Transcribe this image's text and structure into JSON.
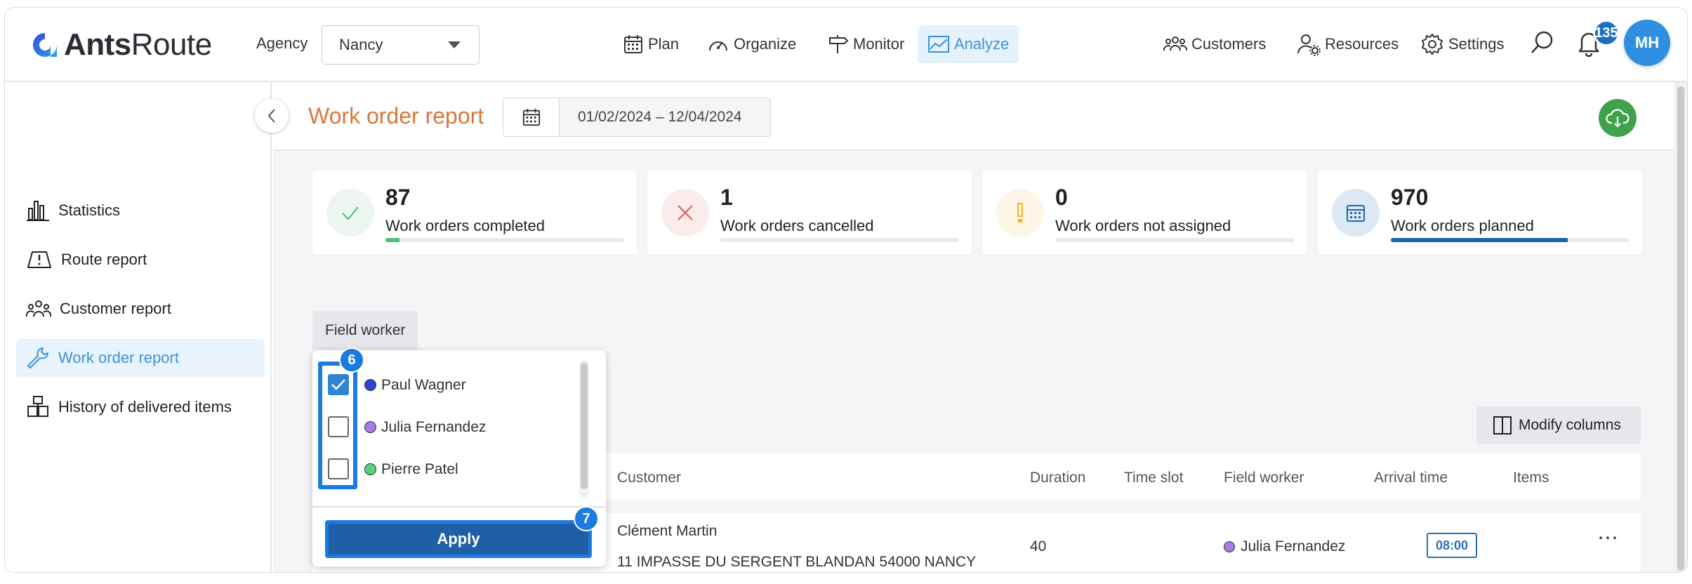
{
  "app": {
    "logo_bold": "Ants",
    "logo_rest": "Route"
  },
  "agency": {
    "label": "Agency",
    "value": "Nancy"
  },
  "nav": {
    "plan": "Plan",
    "organize": "Organize",
    "monitor": "Monitor",
    "analyze": "Analyze",
    "customers": "Customers",
    "resources": "Resources",
    "settings": "Settings"
  },
  "notifications": {
    "count": "135"
  },
  "user": {
    "initials": "MH"
  },
  "sidebar": {
    "items": [
      {
        "label": "Statistics"
      },
      {
        "label": "Route report"
      },
      {
        "label": "Customer report"
      },
      {
        "label": "Work order report"
      },
      {
        "label": "History of delivered items"
      }
    ]
  },
  "page": {
    "title": "Work order report",
    "date_range": "01/02/2024 – 12/04/2024"
  },
  "stats": [
    {
      "value": "87",
      "label": "Work orders completed",
      "fraction": 0.06,
      "color": "#4bbf7b"
    },
    {
      "value": "1",
      "label": "Work orders cancelled",
      "fraction": 0.0,
      "color": "#e05a5a"
    },
    {
      "value": "0",
      "label": "Work orders not assigned",
      "fraction": 0.0,
      "color": "#f2b320"
    },
    {
      "value": "970",
      "label": "Work orders planned",
      "fraction": 0.74,
      "color": "#1e64ad"
    }
  ],
  "filter": {
    "tab_label": "Field worker",
    "options": [
      {
        "name": "Paul Wagner",
        "checked": true,
        "color": "#2f44d6"
      },
      {
        "name": "Julia Fernandez",
        "checked": false,
        "color": "#a77ae6"
      },
      {
        "name": "Pierre Patel",
        "checked": false,
        "color": "#59d27a"
      }
    ],
    "apply_label": "Apply",
    "step_checkbox": "6",
    "step_apply": "7"
  },
  "table": {
    "modify_columns": "Modify columns",
    "headers": [
      "Customer",
      "Duration",
      "Time slot",
      "Field worker",
      "Arrival time",
      "Items"
    ],
    "rows": [
      {
        "customer": "Clément Martin",
        "address": "11 IMPASSE DU SERGENT BLANDAN 54000 NANCY",
        "duration": "40",
        "time_slot": "",
        "field_worker": "Julia Fernandez",
        "worker_color": "#a77ae6",
        "arrival": "08:00",
        "more": "⋯"
      }
    ]
  }
}
